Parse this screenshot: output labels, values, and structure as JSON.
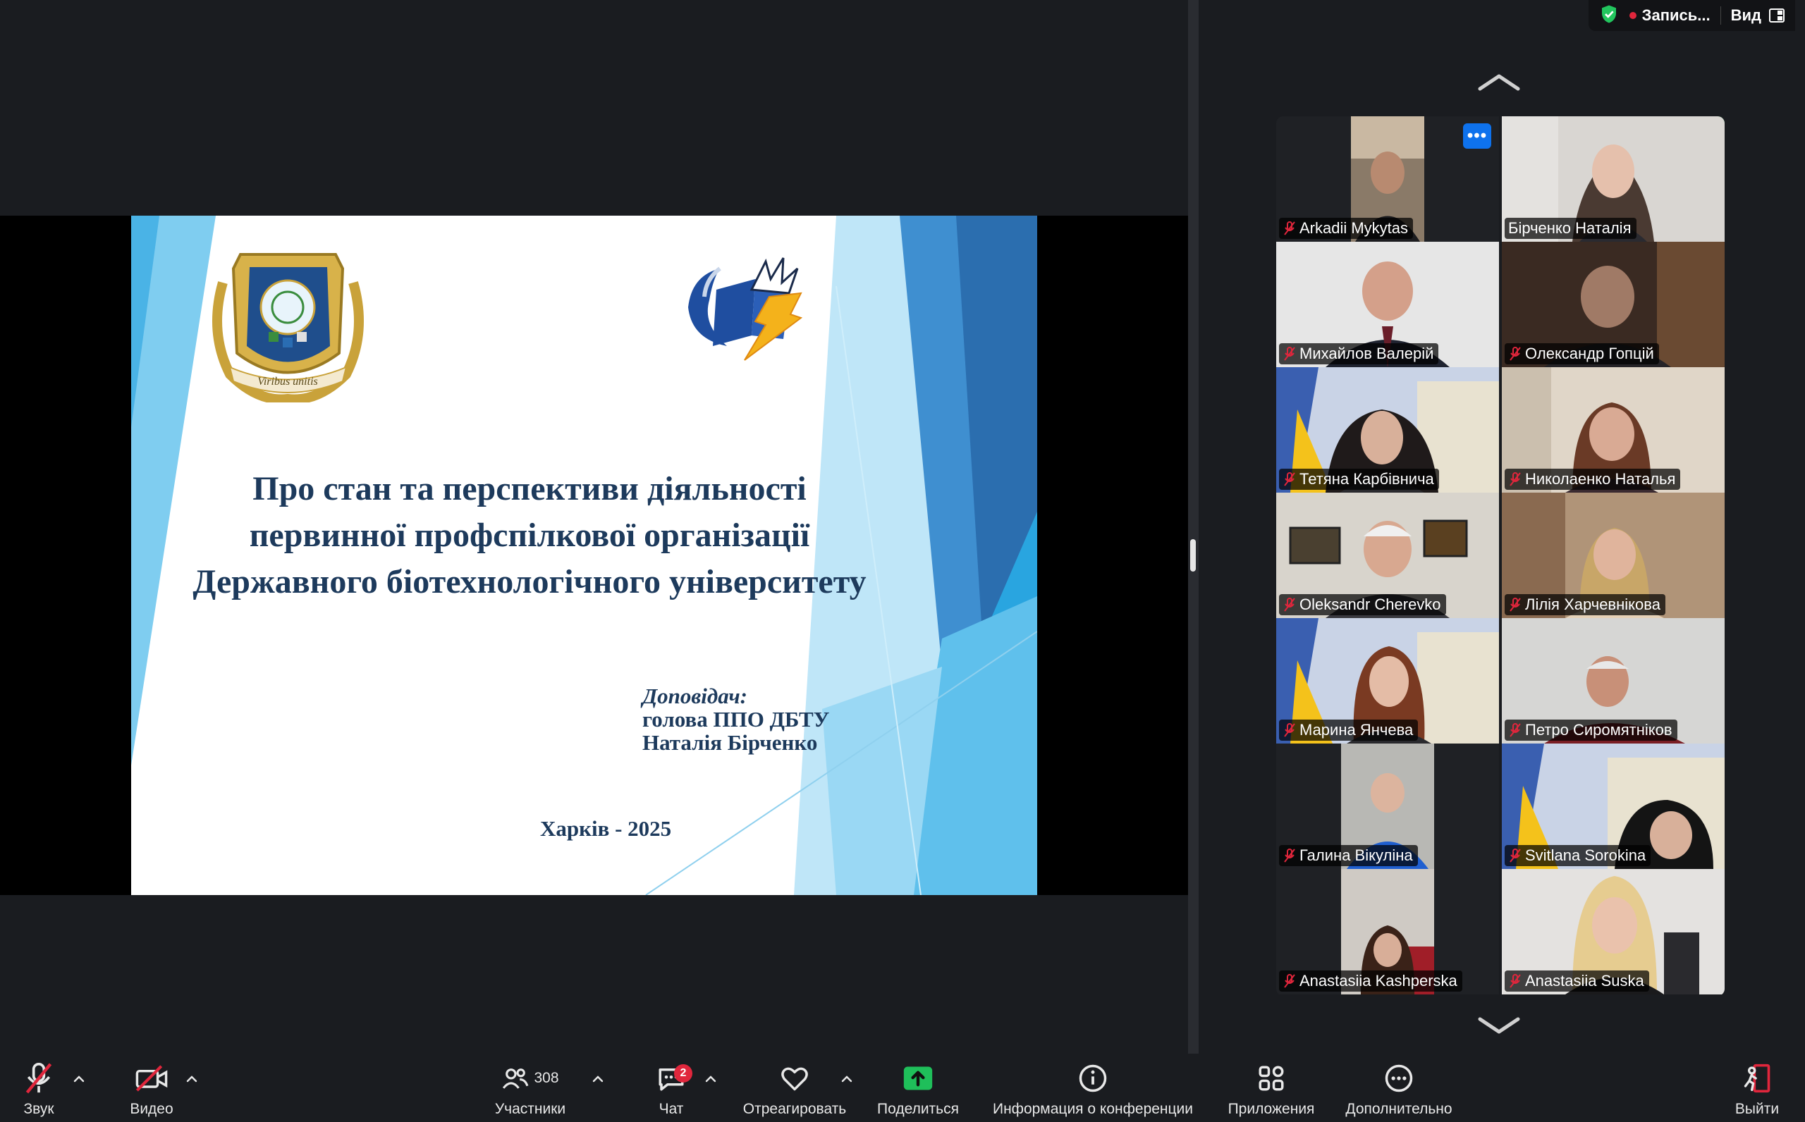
{
  "status": {
    "recording_label": "Запись...",
    "view_label": "Вид"
  },
  "slide": {
    "title_lines": [
      "Про стан та перспективи діяльності",
      "первинної профспілкової організації",
      "Державного біотехнологічного університету"
    ],
    "speaker_label": "Доповідач:",
    "speaker_lines": [
      "голова ППО ДБТУ",
      "Наталія Бірченко"
    ],
    "city_year": "Харків - 2025",
    "emblem_text": "Viribus unitis"
  },
  "gallery": {
    "more_label": "•••",
    "participants": [
      {
        "name": "Arkadii Mykytas",
        "muted": true
      },
      {
        "name": "Бірченко Наталія",
        "muted": false,
        "active": true
      },
      {
        "name": "Михайлов Валерій",
        "muted": true
      },
      {
        "name": "Олександр Гопцій",
        "muted": true
      },
      {
        "name": "Тетяна Карбівнича",
        "muted": true
      },
      {
        "name": "Николаенко Наталья",
        "muted": true
      },
      {
        "name": "Oleksandr Cherevko",
        "muted": true
      },
      {
        "name": "Лілія Харчевнікова",
        "muted": true
      },
      {
        "name": "Марина Янчева",
        "muted": true
      },
      {
        "name": "Петро Сиромятніков",
        "muted": true
      },
      {
        "name": "Галина Вікуліна",
        "muted": true
      },
      {
        "name": "Svitlana Sorokina",
        "muted": true
      },
      {
        "name": "Anastasiia Kashperska",
        "muted": true
      },
      {
        "name": "Anastasiia Suska",
        "muted": true
      }
    ]
  },
  "toolbar": {
    "audio_label": "Звук",
    "video_label": "Видео",
    "participants_label": "Участники",
    "participants_count": "308",
    "chat_label": "Чат",
    "chat_badge": "2",
    "react_label": "Отреагировать",
    "share_label": "Поделиться",
    "info_label": "Информация о конференции",
    "apps_label": "Приложения",
    "more_label": "Дополнительно",
    "leave_label": "Выйти"
  },
  "colors": {
    "accent_blue": "#0e72ed",
    "share_green": "#1fbf5a",
    "active_outline": "#22c55e",
    "muted_red": "#e0263c",
    "slide_text": "#1d3a5c"
  }
}
